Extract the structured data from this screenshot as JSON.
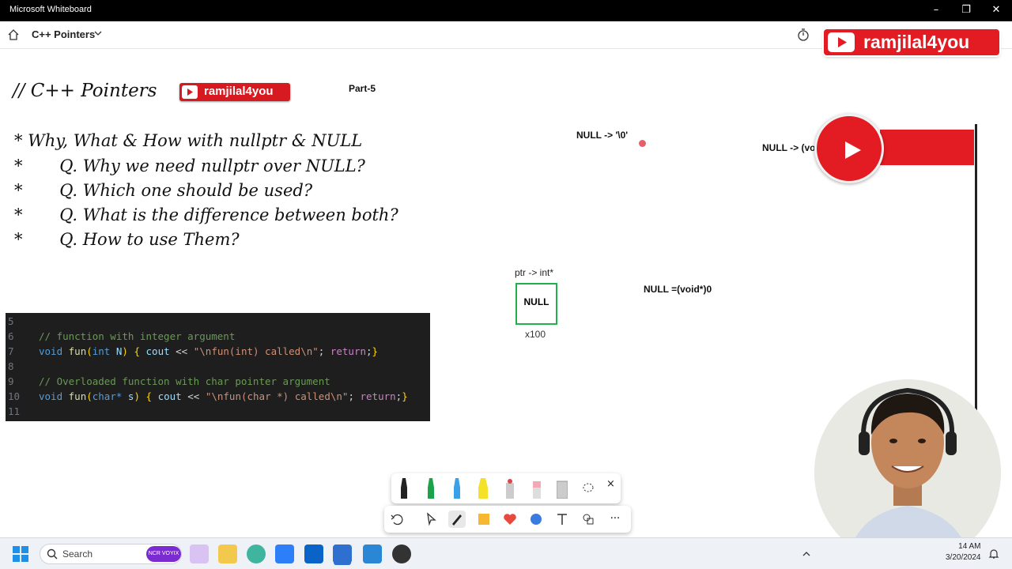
{
  "window": {
    "title": "Microsoft Whiteboard",
    "minimize": "–",
    "maximize": "❐",
    "close": "✕"
  },
  "header": {
    "board_title": "C++ Pointers"
  },
  "whiteboard": {
    "heading": "// C++ Pointers",
    "badge_label": "ramjilal4you",
    "part_label": "Part-5",
    "bullets": [
      "* Why, What & How with nullptr & NULL",
      "*       Q. Why we need nullptr over NULL?",
      "*       Q. Which one should be used?",
      "*       Q. What is the difference between both?",
      "*       Q. How to use Them?"
    ],
    "notes": {
      "null_char": "NULL -> '\\0'",
      "null_void": "NULL -> (void*) 0",
      "null_eq": "NULL =(void*)0",
      "ptr_label": "ptr -> int*",
      "box_value": "NULL",
      "address": "x100"
    }
  },
  "code": {
    "line_numbers": [
      "5",
      "6",
      "7",
      "8",
      "9",
      "10",
      "11"
    ],
    "comment1": "// function with integer argument",
    "comment2": "// Overloaded function with char pointer argument",
    "line7": {
      "kw": "void",
      "fn": "fun",
      "p1": "(",
      "type": "int",
      "arg": "N",
      "p2": ")",
      "b1": "{",
      "cout": "cout",
      "op": "<<",
      "str": "\"\\nfun(int) called\\n\"",
      "semi": ";",
      "ret": "return",
      "semi2": ";",
      "b2": "}"
    },
    "line10": {
      "kw": "void",
      "fn": "fun",
      "p1": "(",
      "type": "char*",
      "arg": "s",
      "p2": ")",
      "b1": "{",
      "cout": "cout",
      "op": "<<",
      "str": "\"\\nfun(char *) called\\n\"",
      "semi": ";",
      "ret": "return",
      "semi2": ";",
      "b2": "}"
    }
  },
  "overlay": {
    "channel": "ramjilal4you"
  },
  "pen_tray": {
    "close": "×"
  },
  "toolbar": {
    "more": "···"
  },
  "taskbar": {
    "search_placeholder": "Search",
    "search_pill": "NCR VOYIX",
    "time": "14 AM",
    "date": "3/20/2024"
  },
  "colors": {
    "brand_red": "#e31b23",
    "code_bg": "#1e1e1e",
    "box_green": "#22b14c"
  }
}
